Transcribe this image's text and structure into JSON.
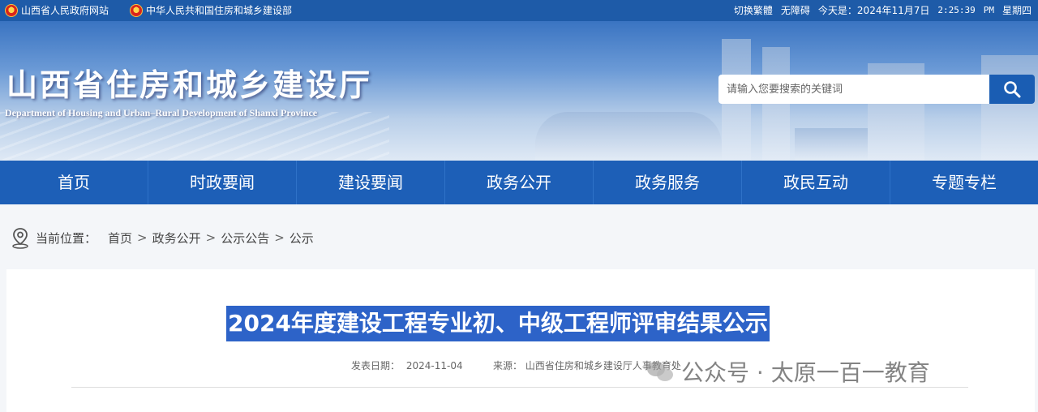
{
  "topbar": {
    "links": [
      {
        "label": "山西省人民政府网站",
        "icon": "emblem-icon"
      },
      {
        "label": "中华人民共和国住房和城乡建设部",
        "icon": "emblem-icon"
      }
    ],
    "switch_label": "切换繁體",
    "accessibility_label": "无障碍",
    "today_label": "今天是：2024年11月7日",
    "time": "2:25:39",
    "ampm": "PM",
    "weekday": "星期四"
  },
  "banner": {
    "title": "山西省住房和城乡建设厅",
    "subtitle": "Department of Housing and Urban–Rural Development of Shanxi Province"
  },
  "search": {
    "placeholder": "请输入您要搜索的关键词",
    "button_icon": "search-icon"
  },
  "nav": {
    "items": [
      "首页",
      "时政要闻",
      "建设要闻",
      "政务公开",
      "政务服务",
      "政民互动",
      "专题专栏"
    ]
  },
  "breadcrumb": {
    "icon": "location-pin-icon",
    "prefix": "当前位置：",
    "items": [
      "首页",
      "政务公开",
      "公示公告",
      "公示"
    ],
    "separator": ">"
  },
  "article": {
    "title": "2024年度建设工程专业初、中级工程师评审结果公示",
    "date_label": "发表日期：",
    "date": "2024-11-04",
    "source_label": "来源：",
    "source": "山西省住房和城乡建设厅人事教育处",
    "watermark": "公众号 · 太原一百一教育"
  },
  "colors": {
    "topbar": "#1e5ba8",
    "nav": "#1d5fb7",
    "search_button": "#1a5db3",
    "title_highlight": "#2d63c8"
  }
}
